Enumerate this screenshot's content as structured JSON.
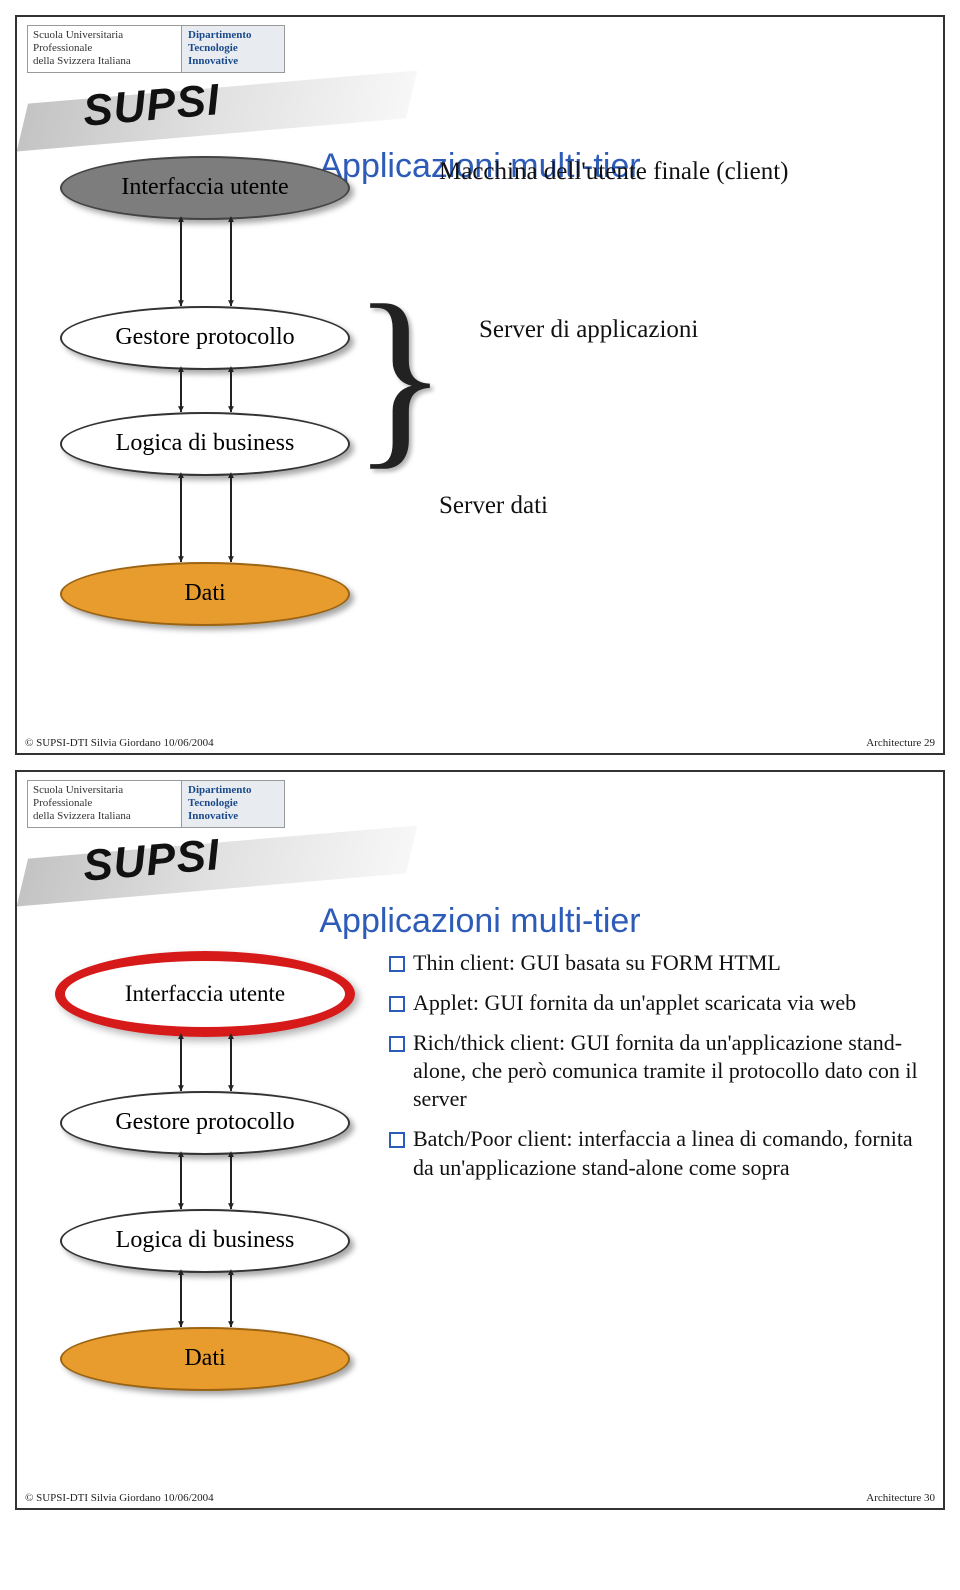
{
  "header": {
    "org_line1": "Scuola Universitaria Professionale",
    "org_line2": "della Svizzera Italiana",
    "dept_line1": "Dipartimento",
    "dept_line2": "Tecnologie",
    "dept_line3": "Innovative",
    "logo": "SUPSI"
  },
  "slide1": {
    "title": "Applicazioni multi-tier",
    "tiers": {
      "ui": "Interfaccia utente",
      "proto": "Gestore protocollo",
      "logic": "Logica di business",
      "data": "Dati"
    },
    "right": {
      "client": "Macchina dell'utente finale (client)",
      "appserver": "Server di applicazioni",
      "dataserver": "Server dati"
    },
    "footer_left": "© SUPSI-DTI    Silvia Giordano    10/06/2004",
    "footer_right": "Architecture  29"
  },
  "slide2": {
    "title": "Applicazioni multi-tier",
    "tiers": {
      "ui": "Interfaccia utente",
      "proto": "Gestore protocollo",
      "logic": "Logica di business",
      "data": "Dati"
    },
    "bullets": [
      "Thin client: GUI basata su FORM HTML",
      "Applet: GUI fornita da un'applet scaricata via web",
      "Rich/thick client: GUI fornita da un'applicazione stand-alone, che però comunica tramite il protocollo dato con il server",
      "Batch/Poor client: interfaccia a linea di comando, fornita da un'applicazione stand-alone come sopra"
    ],
    "footer_left": "© SUPSI-DTI    Silvia Giordano    10/06/2004",
    "footer_right": "Architecture  30"
  }
}
